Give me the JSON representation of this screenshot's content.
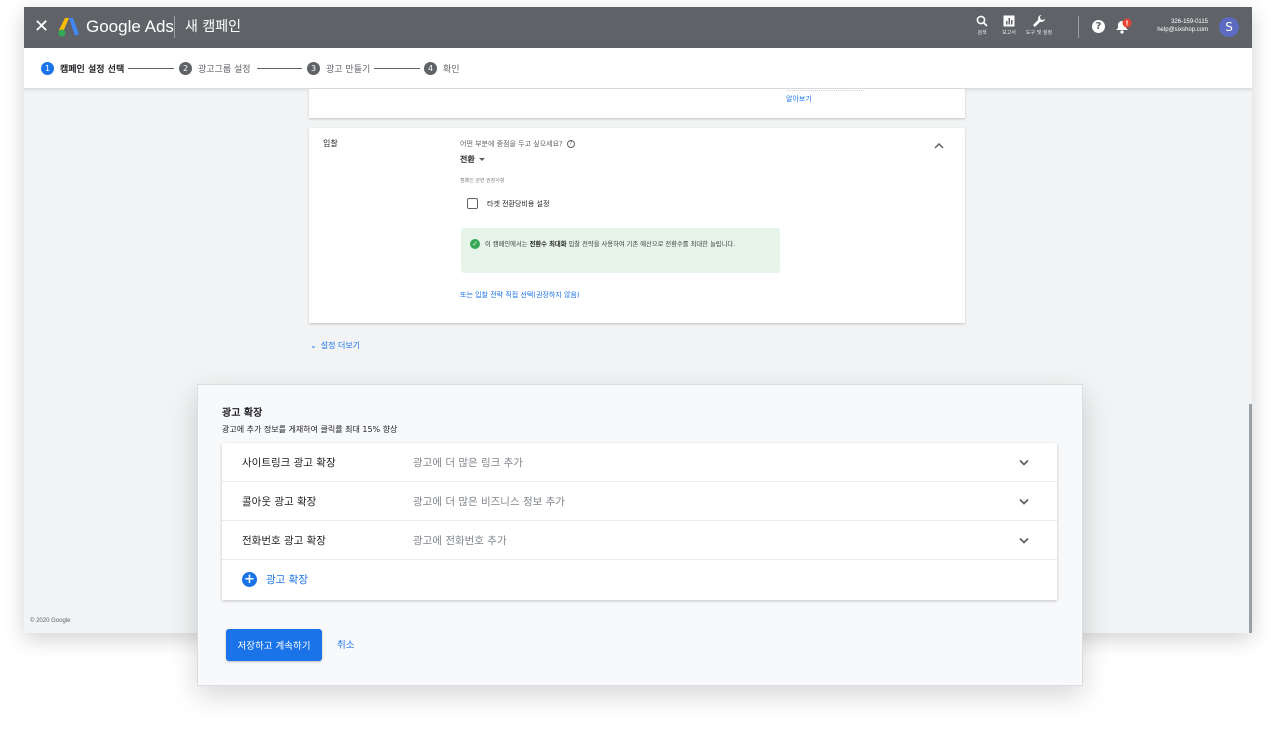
{
  "header": {
    "brand": "Google Ads",
    "campaign_title": "새 캠페인",
    "tools": [
      {
        "label": "검색",
        "icon": "search-icon"
      },
      {
        "label": "보고서",
        "icon": "reports-icon"
      },
      {
        "label": "도구 및 설정",
        "icon": "wrench-icon"
      }
    ],
    "account_id": "326-159-0115",
    "account_email": "help@sixshop.com",
    "avatar_letter": "S"
  },
  "stepper": [
    {
      "num": "1",
      "label": "캠페인 설정 선택",
      "active": true
    },
    {
      "num": "2",
      "label": "광고그룹 설정",
      "active": false
    },
    {
      "num": "3",
      "label": "광고 만들기",
      "active": false
    },
    {
      "num": "4",
      "label": "확인",
      "active": false
    }
  ],
  "top_card": {
    "learn_more": "알아보기"
  },
  "bidding": {
    "title": "입찰",
    "question": "어떤 부분에 중점을 두고 싶으세요?",
    "selected": "전환",
    "recommendation": "캠페인 관련 권장사항",
    "target_checkbox": "타겟 전환당비용 설정",
    "info_pre": "이 캠페인에서는 ",
    "info_bold": "전환수 최대화",
    "info_post": " 입찰 전략을 사용하여 기존 예산으로 전환수를 최대한 늘립니다.",
    "alt_link": "또는 입찰 전략 직접 선택(권장하지 않음)"
  },
  "more_settings": "설정 더보기",
  "footer": {
    "copyright": "© 2020 Google"
  },
  "extensions": {
    "title": "광고 확장",
    "subtitle": "광고에 추가 정보를 게재하여 클릭률 최대 15% 향상",
    "rows": [
      {
        "name": "사이트링크 광고 확장",
        "desc": "광고에 더 많은 링크 추가"
      },
      {
        "name": "콜아웃 광고 확장",
        "desc": "광고에 더 많은 비즈니스 정보 추가"
      },
      {
        "name": "전화번호 광고 확장",
        "desc": "광고에 전화번호 추가"
      }
    ],
    "add_label": "광고 확장",
    "save_label": "저장하고 계속하기",
    "cancel_label": "취소"
  },
  "colors": {
    "topbar": "#5f6368",
    "accent": "#1a73e8",
    "success_bg": "#e6f4ea",
    "success_icon": "#34a853",
    "notification": "#ea4335"
  }
}
